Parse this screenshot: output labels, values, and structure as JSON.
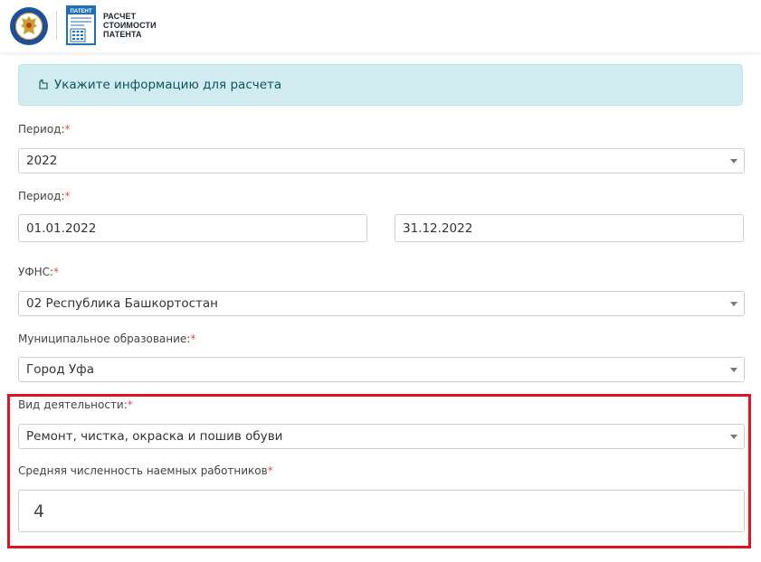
{
  "header": {
    "brand_lines": [
      "РАСЧЕТ",
      "СТОИМОСТИ",
      "ПАТЕНТА"
    ],
    "patent_logo_text": "ПАТЕНТ",
    "emblem_icon": "fns-emblem-icon"
  },
  "alert": {
    "icon": "hand-pointer-icon",
    "text": "Укажите информацию для расчета",
    "bg_color": "#d1ecf1",
    "text_color": "#0c5460"
  },
  "form": {
    "period_year": {
      "label": "Период:",
      "required": "*",
      "value": "2022"
    },
    "period_dates": {
      "label": "Период:",
      "required": "*",
      "from": "01.01.2022",
      "to": "31.12.2022"
    },
    "ufns": {
      "label": "УФНС:",
      "required": "*",
      "value": "02 Республика Башкортостан"
    },
    "municipality": {
      "label": "Муниципальное образование:",
      "required": "*",
      "value": "Город Уфа"
    },
    "activity": {
      "label": "Вид деятельности:",
      "required": "*",
      "value": "Ремонт, чистка, окраска и пошив обуви"
    },
    "employees": {
      "label": "Средняя численность наемных работников",
      "required": "*",
      "value": "4"
    }
  },
  "colors": {
    "required": "#d9534f",
    "highlight": "#e0141f",
    "brand_blue": "#1f6fb5"
  }
}
